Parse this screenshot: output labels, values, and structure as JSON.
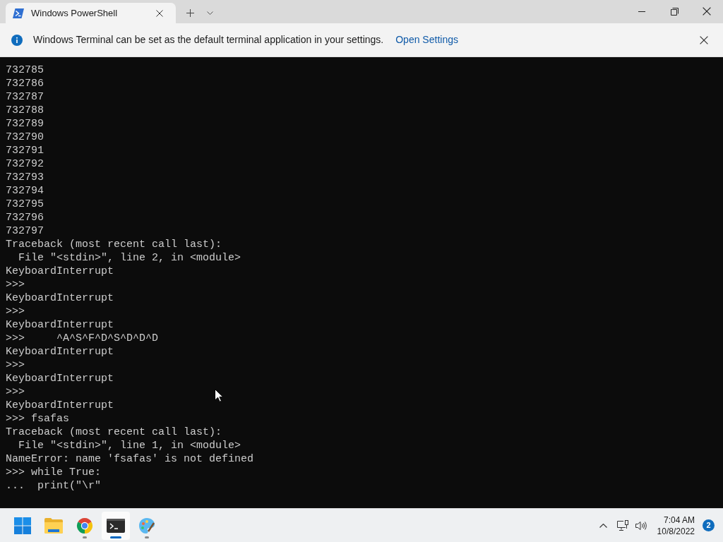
{
  "window": {
    "tabs": [
      {
        "title": "Windows PowerShell",
        "selected": true
      }
    ]
  },
  "info_bar": {
    "message": "Windows Terminal can be set as the default terminal application in your settings.",
    "link": "Open Settings"
  },
  "terminal": {
    "lines": [
      "732785",
      "732786",
      "732787",
      "732788",
      "732789",
      "732790",
      "732791",
      "732792",
      "732793",
      "732794",
      "732795",
      "732796",
      "732797",
      "Traceback (most recent call last):",
      "  File \"<stdin>\", line 2, in <module>",
      "KeyboardInterrupt",
      ">>>",
      "KeyboardInterrupt",
      ">>>",
      "KeyboardInterrupt",
      ">>>     ^A^S^F^D^S^D^D^D",
      "KeyboardInterrupt",
      ">>>",
      "KeyboardInterrupt",
      ">>>",
      "KeyboardInterrupt",
      ">>> fsafas",
      "Traceback (most recent call last):",
      "  File \"<stdin>\", line 1, in <module>",
      "NameError: name 'fsafas' is not defined",
      ">>> while True:",
      "...  print(\"\\r\""
    ]
  },
  "taskbar": {
    "apps": [
      {
        "kind": "start",
        "running": false,
        "selected": false
      },
      {
        "kind": "folder",
        "running": false,
        "selected": false
      },
      {
        "kind": "browser",
        "running": true,
        "selected": false
      },
      {
        "kind": "terminal",
        "running": true,
        "selected": true
      },
      {
        "kind": "paint",
        "running": true,
        "selected": false
      }
    ]
  },
  "tray": {
    "time": "7:04 AM",
    "date": "10/8/2022",
    "notification_count": "2"
  }
}
